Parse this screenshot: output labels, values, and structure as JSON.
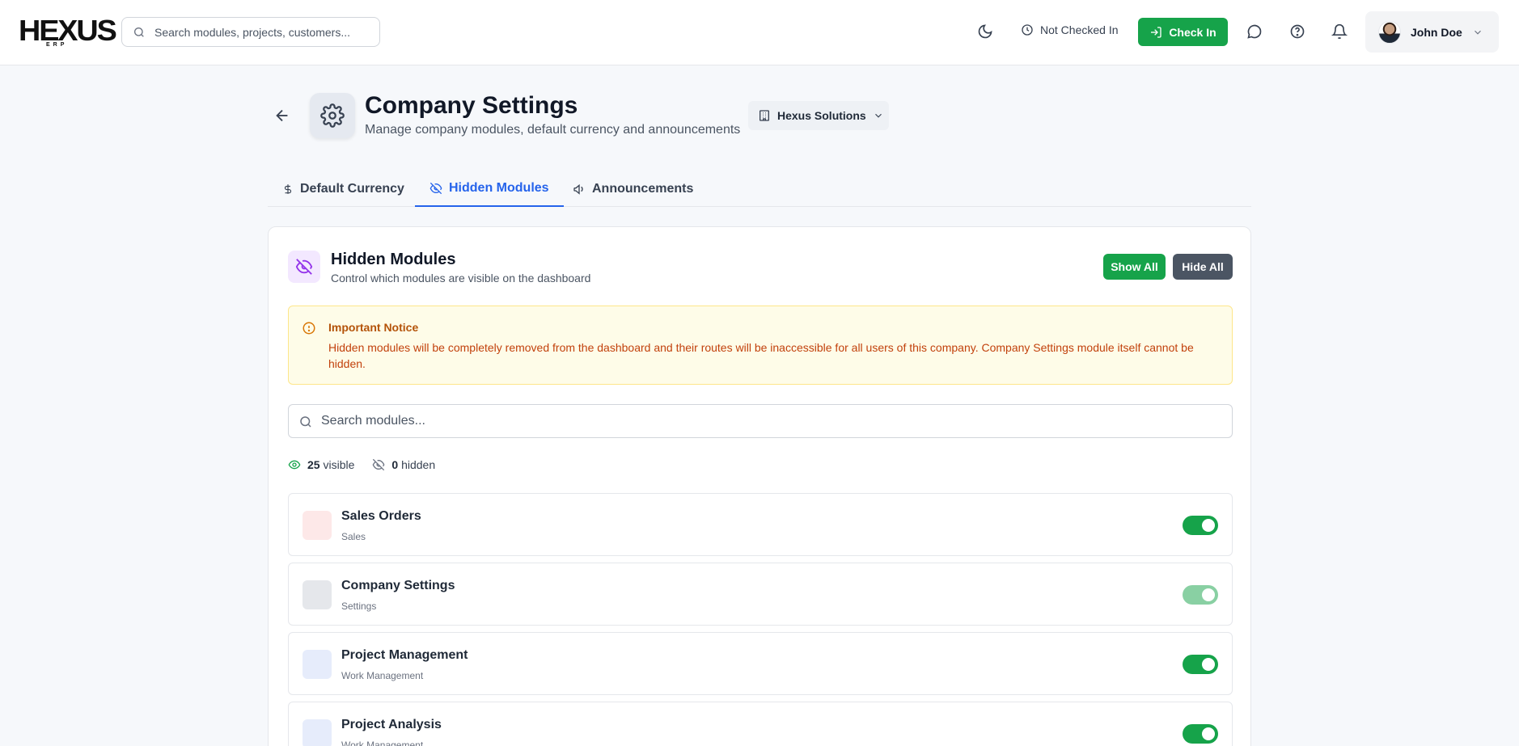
{
  "header": {
    "logo_text": "HEXUS",
    "logo_sub": "ERP",
    "search_placeholder": "Search modules, projects, customers...",
    "status_text": "Not Checked In",
    "checkin_label": "Check In",
    "user_name": "John Doe"
  },
  "page": {
    "title": "Company Settings",
    "subtitle": "Manage company modules, default currency and announcements",
    "company_name": "Hexus Solutions"
  },
  "tabs": [
    {
      "label": "Default Currency",
      "icon": "dollar-icon",
      "active": false
    },
    {
      "label": "Hidden Modules",
      "icon": "eye-off-icon",
      "active": true
    },
    {
      "label": "Announcements",
      "icon": "megaphone-icon",
      "active": false
    }
  ],
  "section": {
    "title": "Hidden Modules",
    "subtitle": "Control which modules are visible on the dashboard",
    "show_all_label": "Show All",
    "hide_all_label": "Hide All"
  },
  "notice": {
    "title": "Important Notice",
    "text": "Hidden modules will be completely removed from the dashboard and their routes will be inaccessible for all users of this company. Company Settings module itself cannot be hidden."
  },
  "module_search_placeholder": "Search modules...",
  "counts": {
    "visible_number": "25",
    "visible_label": "visible",
    "hidden_number": "0",
    "hidden_label": "hidden"
  },
  "modules": [
    {
      "name": "Sales Orders",
      "category": "Sales",
      "icon_color": "#fde8e8",
      "enabled": true,
      "locked": false
    },
    {
      "name": "Company Settings",
      "category": "Settings",
      "icon_color": "#e5e7eb",
      "enabled": true,
      "locked": true
    },
    {
      "name": "Project Management",
      "category": "Work Management",
      "icon_color": "#e6ecfb",
      "enabled": true,
      "locked": false
    },
    {
      "name": "Project Analysis",
      "category": "Work Management",
      "icon_color": "#e6ecfb",
      "enabled": true,
      "locked": false
    }
  ],
  "colors": {
    "primary_green": "#16a34a",
    "active_tab_blue": "#2563eb",
    "notice_text": "#c2410c",
    "purple_accent": "#9333ea"
  }
}
